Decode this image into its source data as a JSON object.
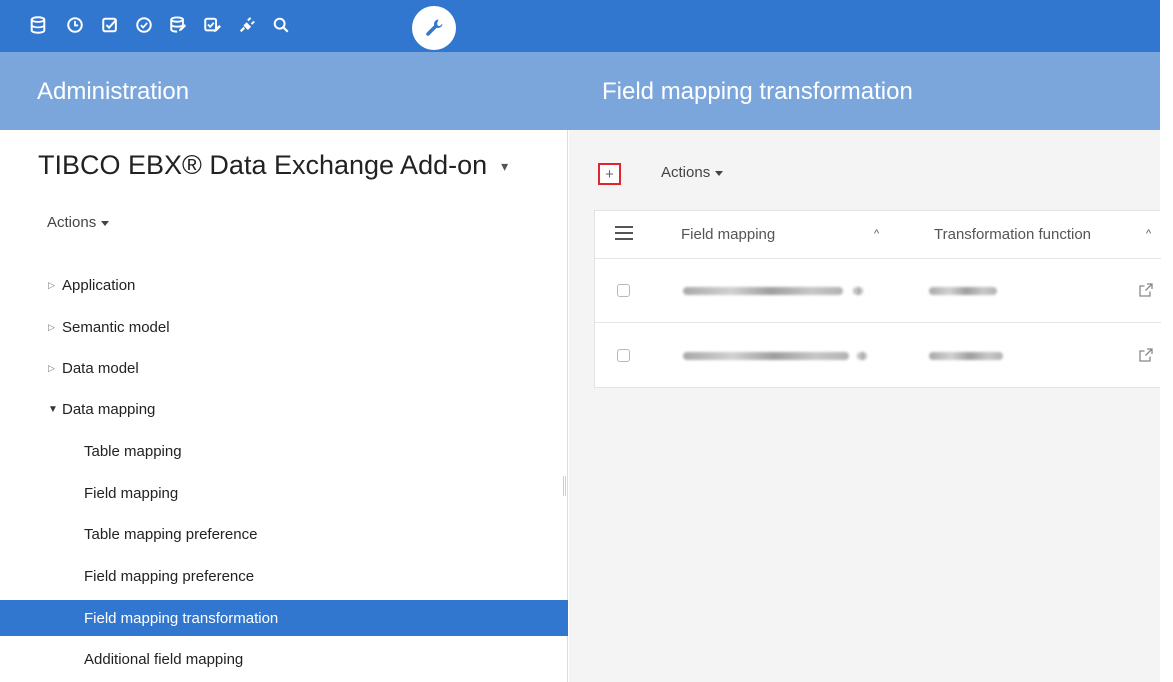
{
  "toolbar": {
    "icons": [
      {
        "name": "database-icon",
        "active": false
      },
      {
        "name": "clock-icon",
        "active": false
      },
      {
        "name": "checkbox-icon",
        "active": false
      },
      {
        "name": "check-circle-icon",
        "active": false
      },
      {
        "name": "database-edit-icon",
        "active": false
      },
      {
        "name": "checkbox-edit-icon",
        "active": false
      },
      {
        "name": "plug-icon",
        "active": false
      },
      {
        "name": "search-icon",
        "active": false
      },
      {
        "name": "wrench-icon",
        "active": true
      }
    ]
  },
  "header": {
    "left_title": "Administration",
    "right_title": "Field mapping transformation"
  },
  "sidebar": {
    "dataset_title": "TIBCO EBX® Data Exchange Add-on",
    "actions_label": "Actions",
    "tree": [
      {
        "label": "Application",
        "expanded": false,
        "level": 0
      },
      {
        "label": "Semantic model",
        "expanded": false,
        "level": 0
      },
      {
        "label": "Data model",
        "expanded": false,
        "level": 0
      },
      {
        "label": "Data mapping",
        "expanded": true,
        "level": 0
      },
      {
        "label": "Table mapping",
        "level": 1
      },
      {
        "label": "Field mapping",
        "level": 1
      },
      {
        "label": "Table mapping preference",
        "level": 1
      },
      {
        "label": "Field mapping preference",
        "level": 1
      },
      {
        "label": "Field mapping transformation",
        "level": 1,
        "selected": true
      },
      {
        "label": "Additional field mapping",
        "level": 1
      }
    ]
  },
  "main": {
    "add_label": "+",
    "actions_label": "Actions",
    "table": {
      "columns": [
        {
          "label": "Field mapping",
          "sort": "^"
        },
        {
          "label": "Transformation function",
          "sort": "^"
        }
      ],
      "rows": [
        {
          "field_mapping": "",
          "transformation_function": ""
        },
        {
          "field_mapping": "",
          "transformation_function": ""
        }
      ]
    }
  },
  "colors": {
    "toolbar": "#3277cf",
    "header": "#7aa6dc",
    "selected": "#3277cf",
    "add_highlight": "#e0262c"
  }
}
